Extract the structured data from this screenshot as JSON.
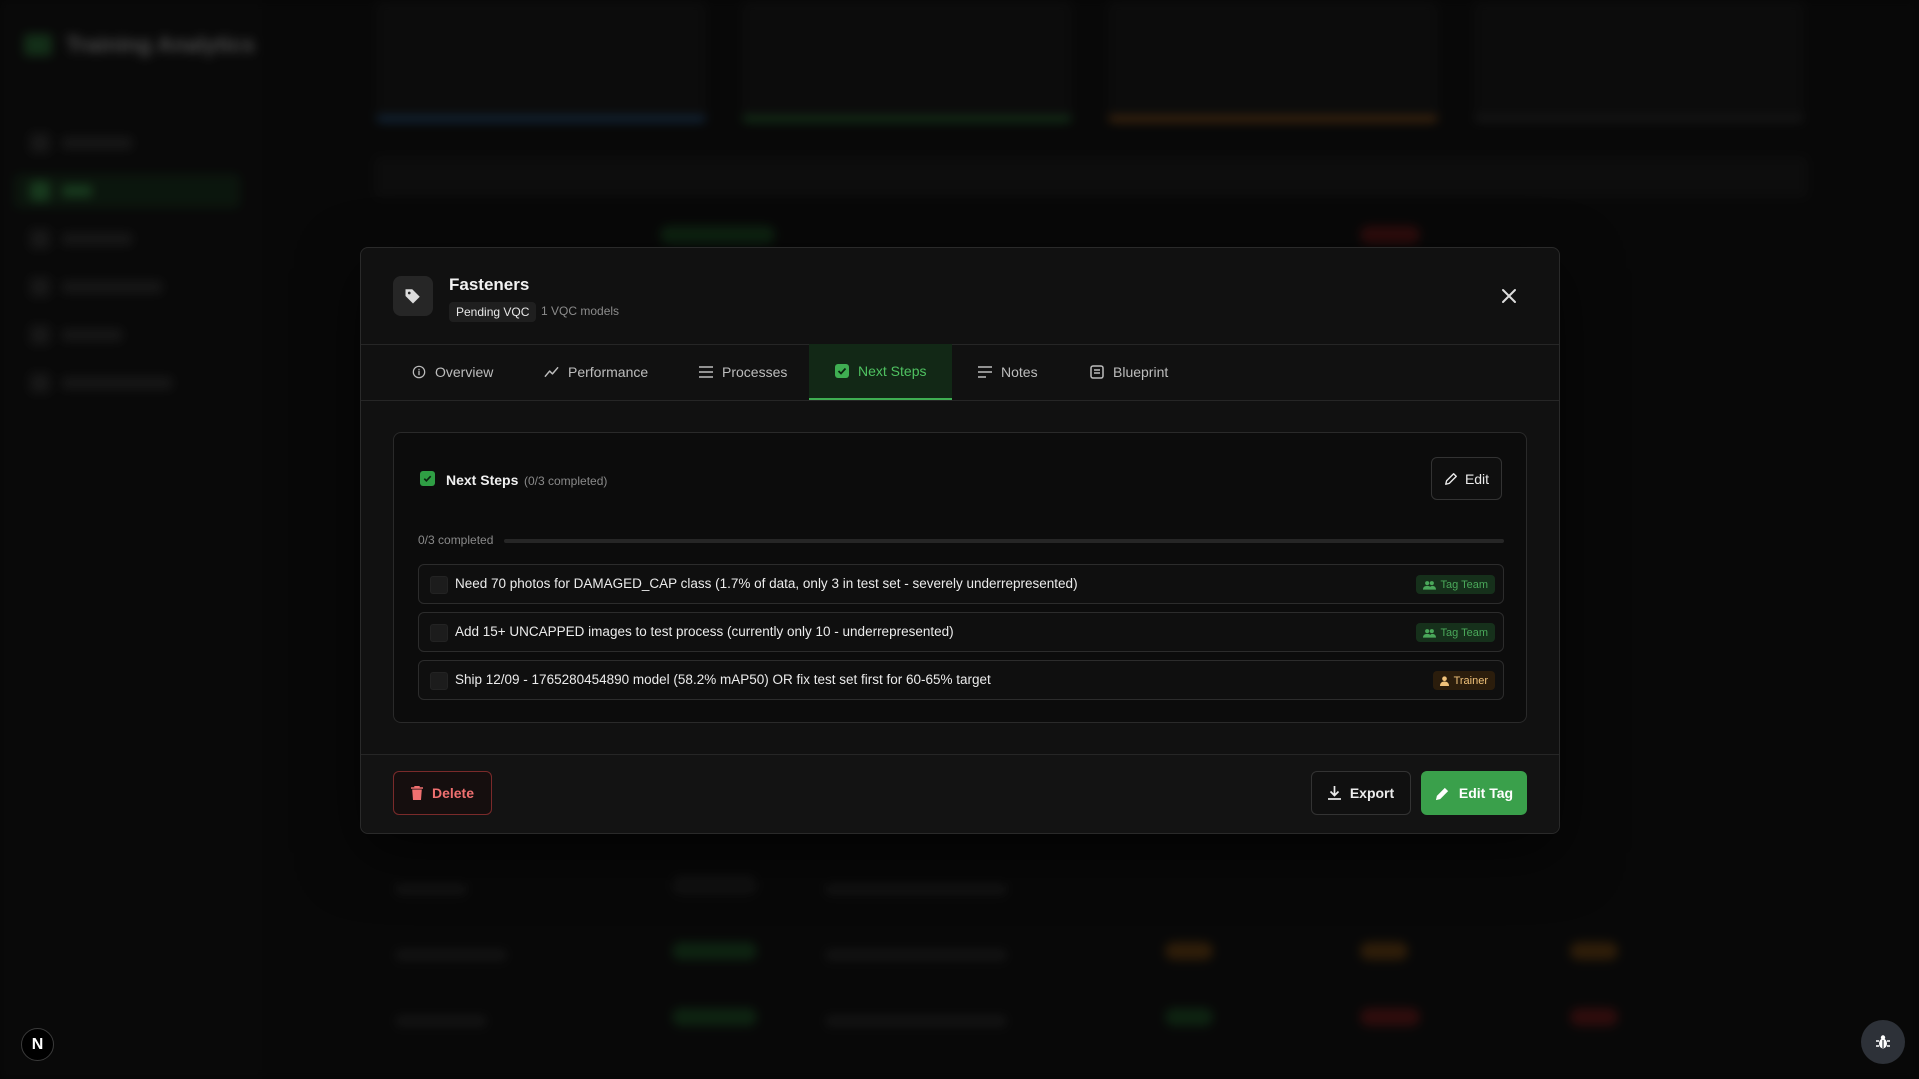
{
  "app": {
    "name": "Training Analytics"
  },
  "modal": {
    "title": "Fasteners",
    "status_badge": "Pending VQC",
    "vqc_models": "1 VQC models",
    "tabs": [
      {
        "label": "Overview",
        "icon": "info-circle-icon"
      },
      {
        "label": "Performance",
        "icon": "trend-line-icon"
      },
      {
        "label": "Processes",
        "icon": "list-icon"
      },
      {
        "label": "Next Steps",
        "icon": "check-square-icon",
        "active": true
      },
      {
        "label": "Notes",
        "icon": "notes-lines-icon"
      },
      {
        "label": "Blueprint",
        "icon": "blueprint-icon"
      }
    ],
    "next_steps": {
      "title": "Next Steps",
      "completed_paren": "(0/3 completed)",
      "edit_label": "Edit",
      "progress_label": "0/3 completed",
      "progress_fraction": 0,
      "items": [
        {
          "text": "Need 70 photos for DAMAGED_CAP class (1.7% of data, only 3 in test set - severely underrepresented)",
          "assignee": "Tag Team",
          "assignee_type": "team",
          "done": false
        },
        {
          "text": "Add 15+ UNCAPPED images to test process (currently only 10 - underrepresented)",
          "assignee": "Tag Team",
          "assignee_type": "team",
          "done": false
        },
        {
          "text": "Ship 12/09 - 1765280454890 model (58.2% mAP50) OR fix test set first for 60-65% target",
          "assignee": "Trainer",
          "assignee_type": "trainer",
          "done": false
        }
      ]
    },
    "footer": {
      "delete_label": "Delete",
      "export_label": "Export",
      "edit_tag_label": "Edit Tag"
    }
  },
  "dev_badge": "N",
  "colors": {
    "accent_green": "#3aa04b",
    "danger_red": "#f07070",
    "trainer_amber": "#f0c27a"
  }
}
